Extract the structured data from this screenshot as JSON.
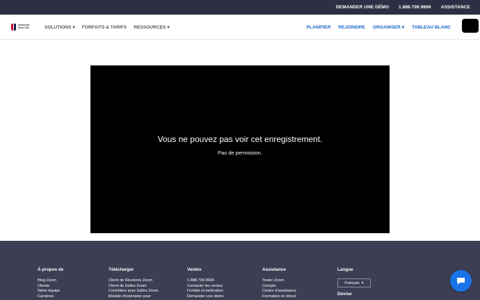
{
  "topbar": {
    "links": [
      "DEMANDER UNE DÉMO",
      "1.888.799.9666",
      "ASSISTANCE"
    ]
  },
  "logo": {
    "lines": [
      "Université",
      "Paris Cité"
    ]
  },
  "nav": {
    "left": [
      {
        "label": "SOLUTIONS",
        "caret": "▾"
      },
      {
        "label": "FORFAITS & TARIFS",
        "caret": ""
      },
      {
        "label": "RESSOURCES",
        "caret": "▾"
      }
    ],
    "right": [
      {
        "label": "PLANIFIER",
        "caret": ""
      },
      {
        "label": "REJOINDRE",
        "caret": ""
      },
      {
        "label": "ORGANISER",
        "caret": "▾"
      },
      {
        "label": "TABLEAU BLANC",
        "caret": ""
      }
    ]
  },
  "player": {
    "message": "Vous ne pouvez pas voir cet enregistrement.",
    "submessage": "Pas de permission."
  },
  "footer": {
    "columns": [
      {
        "heading": "À propos de",
        "links": [
          "Blog Zoom",
          "Clients",
          "Notre équipe",
          "Carrières"
        ]
      },
      {
        "heading": "Télécharger",
        "links": [
          "Client de Réunions Zoom",
          "Client de Salles Zoom",
          "Contrôleur pour Salles Zoom",
          "Module d'extension pour"
        ]
      },
      {
        "heading": "Ventes",
        "links": [
          "1.888.799.9666",
          "Contacter les ventes",
          "Forfaits et tarification",
          "Demander une démo"
        ]
      },
      {
        "heading": "Assistance",
        "links": [
          "Tester Zoom",
          "Compte",
          "Centre d'assistance",
          "Formation en direct"
        ]
      }
    ],
    "language": {
      "heading": "Langue",
      "selected": "Français",
      "caret": "▾",
      "next_heading": "Devise"
    }
  },
  "colors": {
    "topbar_bg": "#2d2f44",
    "footer_bg": "#3c3e53",
    "nav_link_blue": "#1b64c5",
    "chat_button": "#1a73e8"
  },
  "icons": {
    "chat": "chat-bubble-icon",
    "logo": "university-logo-icon"
  }
}
